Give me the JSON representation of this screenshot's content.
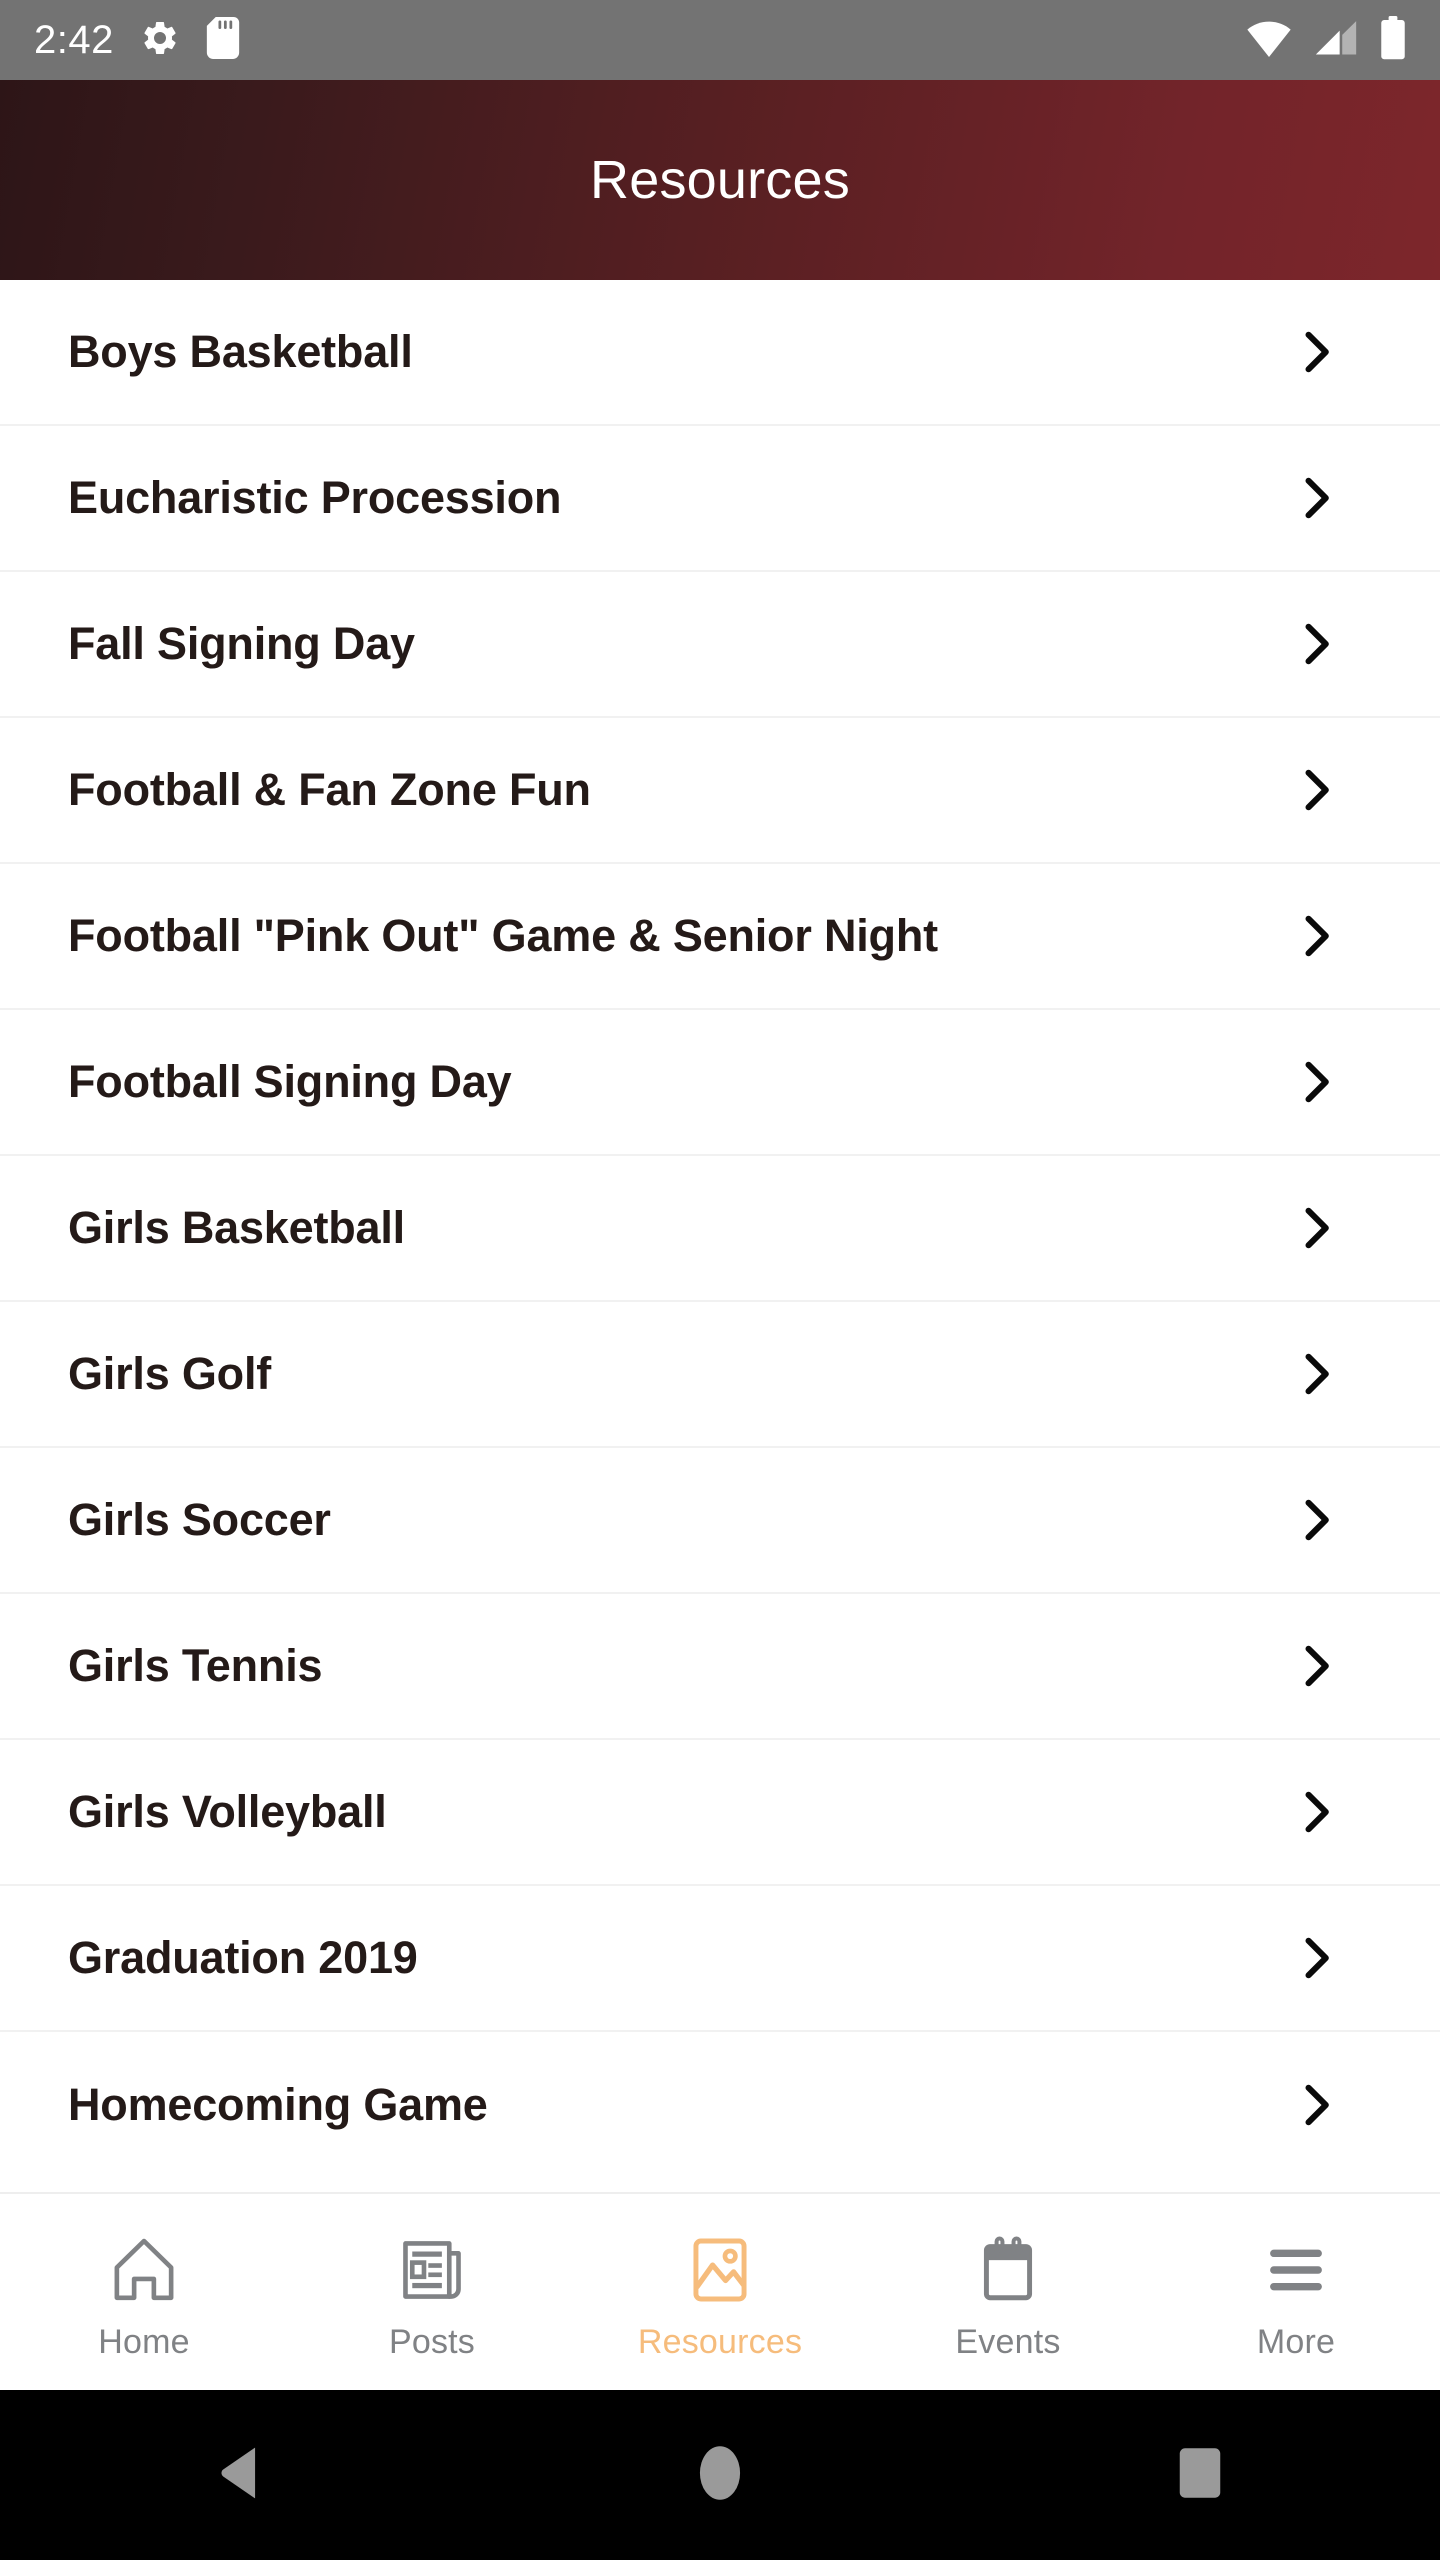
{
  "status_bar": {
    "time": "2:42",
    "left_icons": [
      "gear-icon",
      "sd-card-icon"
    ],
    "right_icons": [
      "wifi-icon",
      "cellular-signal-icon",
      "battery-icon"
    ],
    "background_color": "#737373",
    "foreground_color": "#ffffff"
  },
  "header": {
    "title": "Resources",
    "gradient_from": "#2d1517",
    "gradient_to": "#7d262b",
    "text_color": "#ffffff"
  },
  "list": {
    "items": [
      {
        "label": "Boys Basketball",
        "accessory": "chevron-right-icon"
      },
      {
        "label": "Eucharistic Procession",
        "accessory": "chevron-right-icon"
      },
      {
        "label": "Fall Signing Day",
        "accessory": "chevron-right-icon"
      },
      {
        "label": "Football & Fan Zone Fun",
        "accessory": "chevron-right-icon"
      },
      {
        "label": "Football \"Pink Out\" Game & Senior Night",
        "accessory": "chevron-right-icon"
      },
      {
        "label": "Football Signing Day",
        "accessory": "chevron-right-icon"
      },
      {
        "label": "Girls Basketball",
        "accessory": "chevron-right-icon"
      },
      {
        "label": "Girls Golf",
        "accessory": "chevron-right-icon"
      },
      {
        "label": "Girls Soccer",
        "accessory": "chevron-right-icon"
      },
      {
        "label": "Girls Tennis",
        "accessory": "chevron-right-icon"
      },
      {
        "label": "Girls Volleyball",
        "accessory": "chevron-right-icon"
      },
      {
        "label": "Graduation 2019",
        "accessory": "chevron-right-icon"
      },
      {
        "label": "Homecoming Game",
        "accessory": "chevron-right-icon"
      }
    ],
    "text_color": "#241a18",
    "background_color": "#ffffff"
  },
  "tab_bar": {
    "active_color": "#f6bc7c",
    "inactive_color": "#808285",
    "tabs": [
      {
        "label": "Home",
        "icon": "home-icon",
        "active": false
      },
      {
        "label": "Posts",
        "icon": "news-icon",
        "active": false
      },
      {
        "label": "Resources",
        "icon": "image-icon",
        "active": true
      },
      {
        "label": "Events",
        "icon": "calendar-icon",
        "active": false
      },
      {
        "label": "More",
        "icon": "menu-icon",
        "active": false
      }
    ]
  },
  "system_nav": {
    "background_color": "#000000",
    "icon_color": "#9a9a9a",
    "buttons": [
      {
        "name": "back-button",
        "icon": "triangle-left-icon"
      },
      {
        "name": "home-button",
        "icon": "circle-icon"
      },
      {
        "name": "recents-button",
        "icon": "square-icon"
      }
    ]
  }
}
